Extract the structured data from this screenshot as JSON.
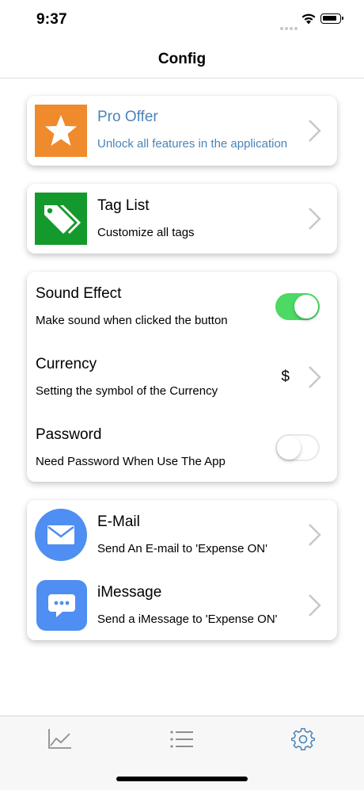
{
  "status_bar": {
    "time": "9:37"
  },
  "nav": {
    "title": "Config"
  },
  "cards": {
    "pro": {
      "title": "Pro Offer",
      "subtitle": "Unlock all features in the application",
      "accent": "#4a84b8",
      "tile_color": "#ef8b2c"
    },
    "tags": {
      "title": "Tag List",
      "subtitle": "Customize all tags",
      "tile_color": "#149a2c"
    },
    "settings": {
      "sound": {
        "title": "Sound Effect",
        "subtitle": "Make sound when clicked the button",
        "enabled": true
      },
      "currency": {
        "title": "Currency",
        "subtitle": "Setting the symbol of the Currency",
        "value": "$"
      },
      "password": {
        "title": "Password",
        "subtitle": "Need Password When Use The App",
        "enabled": false
      }
    },
    "contact": {
      "email": {
        "title": "E-Mail",
        "subtitle": "Send An E-mail to 'Expense ON'"
      },
      "imessage": {
        "title": "iMessage",
        "subtitle": "Send a iMessage to 'Expense ON'"
      }
    }
  },
  "tab_bar": {
    "tabs": [
      {
        "icon": "chart-line-icon",
        "active": false
      },
      {
        "icon": "list-icon",
        "active": false
      },
      {
        "icon": "gear-icon",
        "active": true
      }
    ],
    "active_color": "#4a84b8",
    "inactive_color": "#8e8e93"
  },
  "colors": {
    "toggle_on": "#4cd964",
    "icon_blue": "#4f8ef2"
  }
}
